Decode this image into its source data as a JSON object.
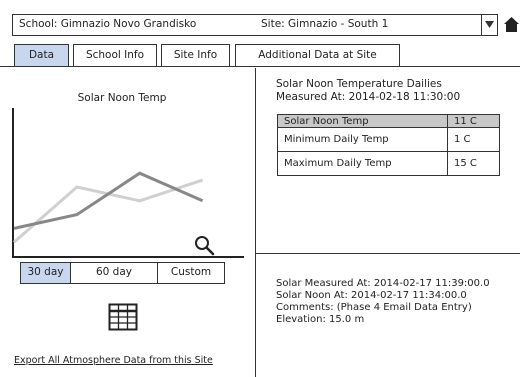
{
  "selector": {
    "school": "School: Gimnazio Novo Grandisko",
    "site": "Site: Gimnazio - South 1"
  },
  "tabs": [
    {
      "label": "Data",
      "active": true
    },
    {
      "label": "School Info",
      "active": false
    },
    {
      "label": "Site Info",
      "active": false
    },
    {
      "label": "Additional Data at Site",
      "active": false
    }
  ],
  "chart": {
    "title": "Solar Noon Temp"
  },
  "chart_data": {
    "type": "line",
    "title": "Solar Noon Temp",
    "x": [
      0,
      1,
      2,
      3
    ],
    "series": [
      {
        "values": [
          2,
          3,
          6,
          4
        ],
        "color": "#888888"
      },
      {
        "values": [
          1,
          5,
          4,
          5.5
        ],
        "color": "#d0d0d0"
      }
    ],
    "xlim": [
      0,
      3.5
    ],
    "ylim": [
      0,
      10
    ],
    "grid": false
  },
  "range_buttons": [
    {
      "label": "30 day",
      "active": true
    },
    {
      "label": "60 day",
      "active": false
    },
    {
      "label": "Custom",
      "active": false
    }
  ],
  "export_link": "Export All Atmosphere Data from this Site",
  "details": {
    "title": "Solar Noon Temperature Dailies",
    "measured_at": "Measured At: 2014-02-18 11:30:00",
    "rows": [
      {
        "label": "Solar Noon Temp",
        "value": "11 C"
      },
      {
        "label": "Minimum Daily Temp",
        "value": "1 C"
      },
      {
        "label": "Maximum Daily Temp",
        "value": "15 C"
      }
    ]
  },
  "info": {
    "solar_measured": "Solar Measured At: 2014-02-17 11:39:00.0",
    "solar_noon": "Solar Noon At: 2014-02-17 11:34:00.0",
    "comments": "Comments: (Phase 4 Email Data Entry)",
    "elevation": "Elevation: 15.0 m"
  },
  "colors": {
    "active_tab": "#c9d7ee",
    "table_header": "#c8c8c8",
    "border": "#333333"
  }
}
